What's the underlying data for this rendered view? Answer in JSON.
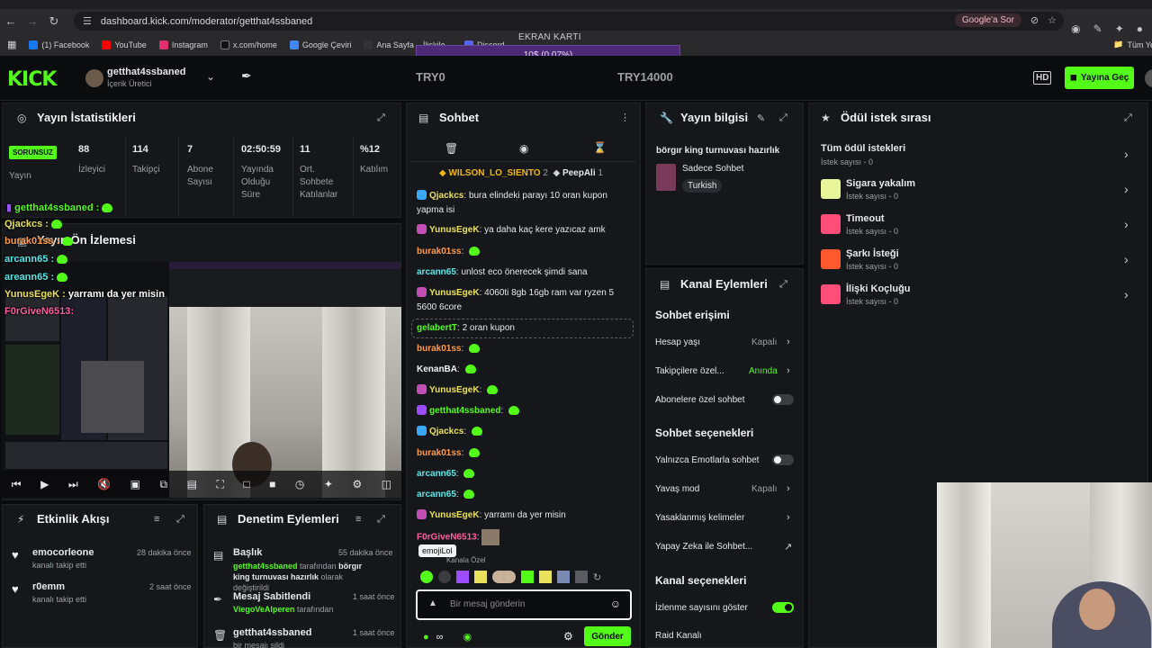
{
  "browser": {
    "url": "dashboard.kick.com/moderator/getthat4ssbaned",
    "google_ask": "Google'a Sor",
    "bookmarks": [
      {
        "label": "(1) Facebook",
        "color": "#1877f2"
      },
      {
        "label": "YouTube",
        "color": "#ff0000"
      },
      {
        "label": "Instagram",
        "color": "#e1306c"
      },
      {
        "label": "x.com/home",
        "color": "#111111"
      },
      {
        "label": "Google Çeviri",
        "color": "#4285f4"
      },
      {
        "label": "Ana Sayfa – İlişkile...",
        "color": "#333333"
      },
      {
        "label": "Discord",
        "color": "#5865f2"
      }
    ],
    "bookmarks_right": "Tüm Yer"
  },
  "gpu": {
    "title": "EKRAN KARTI",
    "bar": "10$ (0.07%)"
  },
  "header": {
    "logo": "KICK",
    "username": "getthat4ssbaned",
    "role": "İçerik Üretici",
    "goal_left": "TRY0",
    "goal_right": "TRY14000",
    "hd": "HD",
    "go_live": "Yayına Geç"
  },
  "stats": {
    "title": "Yayın İstatistikleri",
    "status_badge": "SORUNSUZ",
    "status_label": "Yayın",
    "items": [
      {
        "value": "88",
        "label": "İzleyici"
      },
      {
        "value": "114",
        "label": "Takipçi"
      },
      {
        "value": "7",
        "label": "Abone Sayısı"
      },
      {
        "value": "02:50:59",
        "label": "Yayında Olduğu Süre"
      },
      {
        "value": "11",
        "label": "Ort. Sohbete Katılanlar"
      },
      {
        "value": "%12",
        "label": "Katılım"
      }
    ]
  },
  "preview": {
    "title": "Yayın Ön İzlemesi"
  },
  "overlay_chat": [
    {
      "user": "getthat4ssbaned :",
      "text": "",
      "color": "#53fc18"
    },
    {
      "user": "Qjackcs :",
      "text": "",
      "color": "#e8e25a"
    },
    {
      "user": "burak01ss :",
      "text": "",
      "color": "#ff9c4a"
    },
    {
      "user": "arcann65 :",
      "text": "",
      "color": "#58e8e8"
    },
    {
      "user": "areann65 :",
      "text": "",
      "color": "#58e8e8"
    },
    {
      "user": "YunusEgeK :",
      "text": "yarramı da yer misin",
      "color": "#e8e25a"
    },
    {
      "user": "F0rGiveN6513:",
      "text": "",
      "color": "#ff5ea0"
    }
  ],
  "activity": {
    "title": "Etkinlik Akışı",
    "items": [
      {
        "name": "emocorleone",
        "sub": "kanalı takip etti",
        "time": "28 dakika önce"
      },
      {
        "name": "r0emm",
        "sub": "kanalı takip etti",
        "time": "2 saat önce"
      }
    ]
  },
  "moderation": {
    "title": "Denetim Eylemleri",
    "items": [
      {
        "name": "Başlık",
        "time": "55 dakika önce",
        "actor": "getthat4ssbaned",
        "mid": " tarafından ",
        "detail": "börgır king turnuvası hazırlık",
        "tail": " olarak değiştirildi"
      },
      {
        "name": "Mesaj Sabitlendi",
        "time": "1 saat önce",
        "actor": "ViegoVeAlperen",
        "mid": " tarafından",
        "detail": "",
        "tail": ""
      },
      {
        "name": "getthat4ssbaned",
        "time": "1 saat önce",
        "actor": "",
        "mid": "bir mesajı sildi",
        "detail": "",
        "tail": ""
      }
    ]
  },
  "chat": {
    "title": "Sohbet",
    "top_users": [
      {
        "name": "WILSON_LO_SIENTO",
        "count": "2"
      },
      {
        "name": "PeepAli",
        "count": "1"
      }
    ],
    "messages": [
      {
        "user": "Qjackcs",
        "color": "#e8e25a",
        "badge": "blue",
        "text": "bura elindeki parayı 10 oran kupon yapma isi"
      },
      {
        "user": "YunusEgeK",
        "color": "#e8e25a",
        "badge": "pink",
        "text": "ya daha kaç kere yazıcaz amk"
      },
      {
        "user": "burak01ss",
        "color": "#ff9c4a",
        "badge": "",
        "text": "",
        "emote": true
      },
      {
        "user": "arcann65",
        "color": "#58e8e8",
        "badge": "",
        "text": "unlost eco önerecek şimdi sana"
      },
      {
        "user": "YunusEgeK",
        "color": "#e8e25a",
        "badge": "pink",
        "text": "4060ti 8gb 16gb ram var ryzen 5 5600 6core"
      },
      {
        "user": "gelabertT",
        "color": "#53fc18",
        "badge": "",
        "text": "2 oran kupon"
      },
      {
        "user": "burak01ss",
        "color": "#ff9c4a",
        "badge": "",
        "text": "",
        "emote": true
      },
      {
        "user": "KenanBA",
        "color": "#f1f2f3",
        "badge": "",
        "text": "",
        "emote": true
      },
      {
        "user": "YunusEgeK",
        "color": "#e8e25a",
        "badge": "pink",
        "text": "",
        "emote": true
      },
      {
        "user": "getthat4ssbaned",
        "color": "#53fc18",
        "badge": "purple",
        "text": "",
        "emote": true
      },
      {
        "user": "Qjackcs",
        "color": "#e8e25a",
        "badge": "blue",
        "text": "",
        "emote": true
      },
      {
        "user": "burak01ss",
        "color": "#ff9c4a",
        "badge": "",
        "text": "",
        "emote": true
      },
      {
        "user": "arcann65",
        "color": "#58e8e8",
        "badge": "",
        "text": "",
        "emote": true
      },
      {
        "user": "arcann65",
        "color": "#58e8e8",
        "badge": "",
        "text": "",
        "emote": true
      },
      {
        "user": "YunusEgeK",
        "color": "#e8e25a",
        "badge": "pink",
        "text": "yarramı da yer misin"
      },
      {
        "user": "F0rGiveN6513",
        "color": "#ff5ea0",
        "badge": "",
        "text": ""
      }
    ],
    "tooltip": "emojiLol",
    "emote_section": "Kanala Özel",
    "input_placeholder": "Bir mesaj gönderin",
    "send": "Gönder"
  },
  "stream_info": {
    "title": "Yayın bilgisi",
    "stream_title": "börgır king turnuvası hazırlık",
    "category": "Sadece Sohbet",
    "tag": "Turkish"
  },
  "channel_actions": {
    "title": "Kanal Eylemleri",
    "section1": "Sohbet erişimi",
    "rows1": [
      {
        "label": "Hesap yaşı",
        "value": "Kapalı"
      },
      {
        "label": "Takipçilere özel...",
        "value": "Anında"
      },
      {
        "label": "Abonelere özel sohbet",
        "value": ""
      }
    ],
    "section2": "Sohbet seçenekleri",
    "rows2": [
      {
        "label": "Yalnızca Emotlarla sohbet",
        "value": ""
      },
      {
        "label": "Yavaş mod",
        "value": "Kapalı"
      },
      {
        "label": "Yasaklanmış kelimeler",
        "value": ""
      },
      {
        "label": "Yapay Zeka ile Sohbet...",
        "value": ""
      }
    ],
    "section3": "Kanal seçenekleri",
    "rows3": [
      {
        "label": "İzlenme sayısını göster",
        "value": ""
      },
      {
        "label": "Raid Kanalı",
        "value": ""
      }
    ]
  },
  "rewards": {
    "title": "Ödül istek sırası",
    "items": [
      {
        "title": "Tüm ödül istekleri",
        "sub": "İstek sayısı - 0",
        "color": ""
      },
      {
        "title": "Sigara yakalım",
        "sub": "İstek sayısı - 0",
        "color": "#e8f59a"
      },
      {
        "title": "Timeout",
        "sub": "İstek sayısı - 0",
        "color": "#ff4d7a"
      },
      {
        "title": "Şarkı İsteği",
        "sub": "İstek sayısı - 0",
        "color": "#ff5a2e"
      },
      {
        "title": "İlişki Koçluğu",
        "sub": "İstek sayısı - 0",
        "color": "#ff4d7a"
      }
    ]
  }
}
